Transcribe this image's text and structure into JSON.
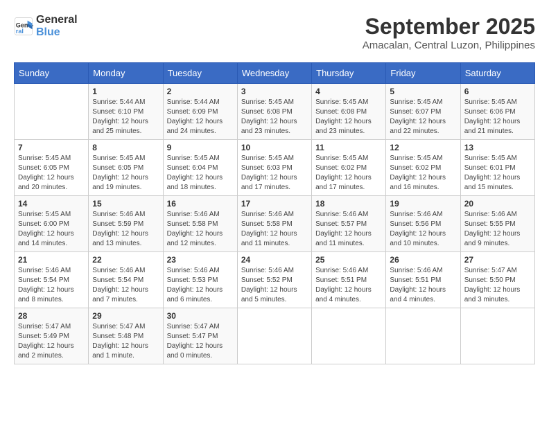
{
  "header": {
    "logo_line1": "General",
    "logo_line2": "Blue",
    "month_title": "September 2025",
    "subtitle": "Amacalan, Central Luzon, Philippines"
  },
  "weekdays": [
    "Sunday",
    "Monday",
    "Tuesday",
    "Wednesday",
    "Thursday",
    "Friday",
    "Saturday"
  ],
  "weeks": [
    [
      {
        "day": "",
        "detail": ""
      },
      {
        "day": "1",
        "detail": "Sunrise: 5:44 AM\nSunset: 6:10 PM\nDaylight: 12 hours\nand 25 minutes."
      },
      {
        "day": "2",
        "detail": "Sunrise: 5:44 AM\nSunset: 6:09 PM\nDaylight: 12 hours\nand 24 minutes."
      },
      {
        "day": "3",
        "detail": "Sunrise: 5:45 AM\nSunset: 6:08 PM\nDaylight: 12 hours\nand 23 minutes."
      },
      {
        "day": "4",
        "detail": "Sunrise: 5:45 AM\nSunset: 6:08 PM\nDaylight: 12 hours\nand 23 minutes."
      },
      {
        "day": "5",
        "detail": "Sunrise: 5:45 AM\nSunset: 6:07 PM\nDaylight: 12 hours\nand 22 minutes."
      },
      {
        "day": "6",
        "detail": "Sunrise: 5:45 AM\nSunset: 6:06 PM\nDaylight: 12 hours\nand 21 minutes."
      }
    ],
    [
      {
        "day": "7",
        "detail": "Sunrise: 5:45 AM\nSunset: 6:05 PM\nDaylight: 12 hours\nand 20 minutes."
      },
      {
        "day": "8",
        "detail": "Sunrise: 5:45 AM\nSunset: 6:05 PM\nDaylight: 12 hours\nand 19 minutes."
      },
      {
        "day": "9",
        "detail": "Sunrise: 5:45 AM\nSunset: 6:04 PM\nDaylight: 12 hours\nand 18 minutes."
      },
      {
        "day": "10",
        "detail": "Sunrise: 5:45 AM\nSunset: 6:03 PM\nDaylight: 12 hours\nand 17 minutes."
      },
      {
        "day": "11",
        "detail": "Sunrise: 5:45 AM\nSunset: 6:02 PM\nDaylight: 12 hours\nand 17 minutes."
      },
      {
        "day": "12",
        "detail": "Sunrise: 5:45 AM\nSunset: 6:02 PM\nDaylight: 12 hours\nand 16 minutes."
      },
      {
        "day": "13",
        "detail": "Sunrise: 5:45 AM\nSunset: 6:01 PM\nDaylight: 12 hours\nand 15 minutes."
      }
    ],
    [
      {
        "day": "14",
        "detail": "Sunrise: 5:45 AM\nSunset: 6:00 PM\nDaylight: 12 hours\nand 14 minutes."
      },
      {
        "day": "15",
        "detail": "Sunrise: 5:46 AM\nSunset: 5:59 PM\nDaylight: 12 hours\nand 13 minutes."
      },
      {
        "day": "16",
        "detail": "Sunrise: 5:46 AM\nSunset: 5:58 PM\nDaylight: 12 hours\nand 12 minutes."
      },
      {
        "day": "17",
        "detail": "Sunrise: 5:46 AM\nSunset: 5:58 PM\nDaylight: 12 hours\nand 11 minutes."
      },
      {
        "day": "18",
        "detail": "Sunrise: 5:46 AM\nSunset: 5:57 PM\nDaylight: 12 hours\nand 11 minutes."
      },
      {
        "day": "19",
        "detail": "Sunrise: 5:46 AM\nSunset: 5:56 PM\nDaylight: 12 hours\nand 10 minutes."
      },
      {
        "day": "20",
        "detail": "Sunrise: 5:46 AM\nSunset: 5:55 PM\nDaylight: 12 hours\nand 9 minutes."
      }
    ],
    [
      {
        "day": "21",
        "detail": "Sunrise: 5:46 AM\nSunset: 5:54 PM\nDaylight: 12 hours\nand 8 minutes."
      },
      {
        "day": "22",
        "detail": "Sunrise: 5:46 AM\nSunset: 5:54 PM\nDaylight: 12 hours\nand 7 minutes."
      },
      {
        "day": "23",
        "detail": "Sunrise: 5:46 AM\nSunset: 5:53 PM\nDaylight: 12 hours\nand 6 minutes."
      },
      {
        "day": "24",
        "detail": "Sunrise: 5:46 AM\nSunset: 5:52 PM\nDaylight: 12 hours\nand 5 minutes."
      },
      {
        "day": "25",
        "detail": "Sunrise: 5:46 AM\nSunset: 5:51 PM\nDaylight: 12 hours\nand 4 minutes."
      },
      {
        "day": "26",
        "detail": "Sunrise: 5:46 AM\nSunset: 5:51 PM\nDaylight: 12 hours\nand 4 minutes."
      },
      {
        "day": "27",
        "detail": "Sunrise: 5:47 AM\nSunset: 5:50 PM\nDaylight: 12 hours\nand 3 minutes."
      }
    ],
    [
      {
        "day": "28",
        "detail": "Sunrise: 5:47 AM\nSunset: 5:49 PM\nDaylight: 12 hours\nand 2 minutes."
      },
      {
        "day": "29",
        "detail": "Sunrise: 5:47 AM\nSunset: 5:48 PM\nDaylight: 12 hours\nand 1 minute."
      },
      {
        "day": "30",
        "detail": "Sunrise: 5:47 AM\nSunset: 5:47 PM\nDaylight: 12 hours\nand 0 minutes."
      },
      {
        "day": "",
        "detail": ""
      },
      {
        "day": "",
        "detail": ""
      },
      {
        "day": "",
        "detail": ""
      },
      {
        "day": "",
        "detail": ""
      }
    ]
  ]
}
